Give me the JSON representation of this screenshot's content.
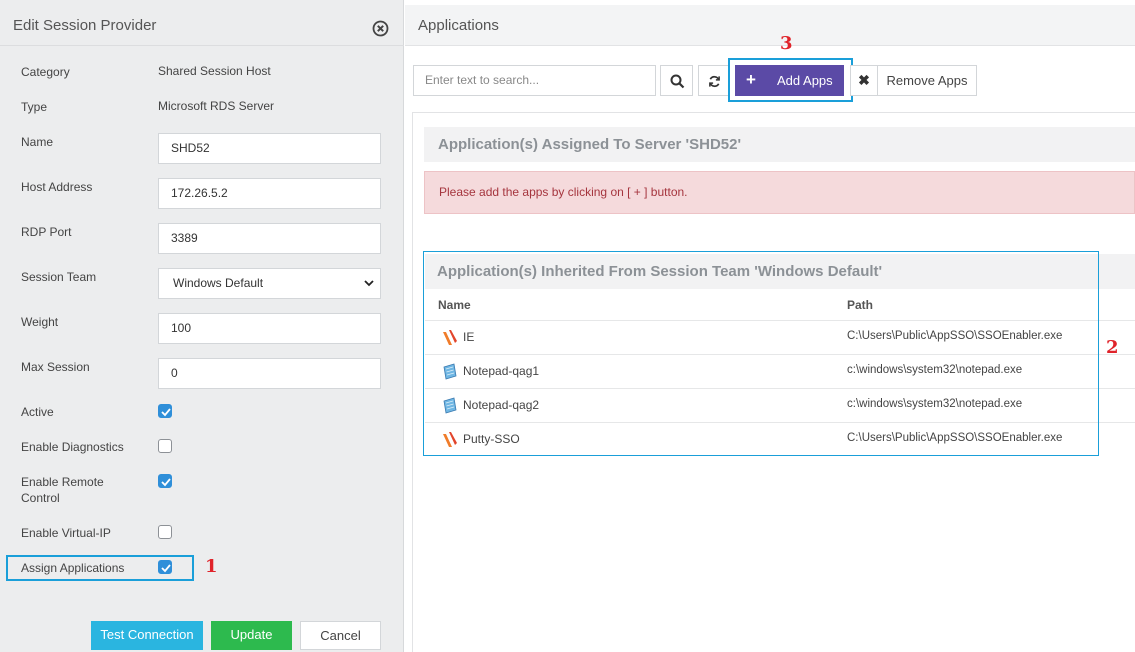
{
  "left_panel": {
    "title": "Edit Session Provider",
    "fields": {
      "category": {
        "label": "Category",
        "value": "Shared Session Host"
      },
      "type": {
        "label": "Type",
        "value": "Microsoft RDS Server"
      },
      "name": {
        "label": "Name",
        "value": "SHD52"
      },
      "host_address": {
        "label": "Host Address",
        "value": "172.26.5.2"
      },
      "rdp_port": {
        "label": "RDP Port",
        "value": "3389"
      },
      "session_team": {
        "label": "Session Team",
        "value": "Windows Default"
      },
      "weight": {
        "label": "Weight",
        "value": "100"
      },
      "max_session": {
        "label": "Max Session",
        "value": "0"
      }
    },
    "checkboxes": {
      "active": {
        "label": "Active",
        "checked": true
      },
      "enable_diagnostics": {
        "label": "Enable Diagnostics",
        "checked": false
      },
      "enable_remote_control": {
        "label": "Enable Remote Control",
        "checked": true
      },
      "enable_virtual_ip": {
        "label": "Enable Virtual-IP",
        "checked": false
      },
      "assign_applications": {
        "label": "Assign Applications",
        "checked": true
      }
    },
    "buttons": {
      "test_connection": "Test Connection",
      "update": "Update",
      "cancel": "Cancel"
    }
  },
  "right_panel": {
    "title": "Applications",
    "search_placeholder": "Enter text to search...",
    "add_apps_label": "Add Apps",
    "add_apps_plus": "+",
    "remove_x": "✖",
    "remove_apps_label": "Remove Apps",
    "assigned_title": "Application(s) Assigned To Server 'SHD52'",
    "assigned_alert": "Please add the apps by clicking on [ + ] button.",
    "inherited_title": "Application(s) Inherited From Session Team 'Windows Default'",
    "columns": {
      "name": "Name",
      "path": "Path"
    },
    "rows": [
      {
        "name": "IE",
        "path": "C:\\Users\\Public\\AppSSO\\SSOEnabler.exe",
        "icon": "sso-enabler-icon"
      },
      {
        "name": "Notepad-qag1",
        "path": "c:\\windows\\system32\\notepad.exe",
        "icon": "notepad-icon"
      },
      {
        "name": "Notepad-qag2",
        "path": "c:\\windows\\system32\\notepad.exe",
        "icon": "notepad-icon"
      },
      {
        "name": "Putty-SSO",
        "path": "C:\\Users\\Public\\AppSSO\\SSOEnabler.exe",
        "icon": "sso-enabler-icon"
      }
    ]
  },
  "annotations": {
    "marker_1": "1",
    "marker_2": "2",
    "marker_3": "3"
  },
  "colors": {
    "accent_purple": "#5b4aa6",
    "checkbox_blue": "#2f8fd9",
    "highlight_blue": "#1a9fd9",
    "marker_red": "#e0232a",
    "test_button": "#2ab5e0",
    "update_button": "#2dba4e",
    "alert_bg": "#f5dadc"
  }
}
